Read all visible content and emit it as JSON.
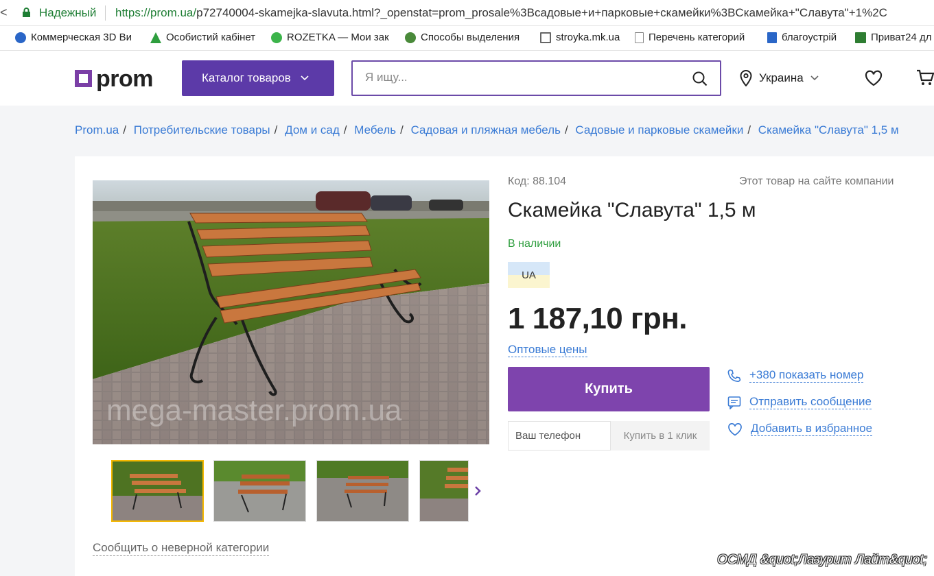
{
  "browser": {
    "back_glyph": "<",
    "secure_label": "Надежный",
    "url_host": "https://prom.ua/",
    "url_rest": "p72740004-skamejka-slavuta.html?_openstat=prom_prosale%3Bсадовые+и+парковые+скамейки%3BСкамейка+\"Славута\"+1%2C"
  },
  "bookmarks": [
    {
      "label": "Коммерческая 3D Ви",
      "icon": "3d-icon",
      "color": "#2a66c7"
    },
    {
      "label": "Особистий кабінет",
      "icon": "tree-icon",
      "color": "#2e9e3e"
    },
    {
      "label": "ROZETKA — Мои зак",
      "icon": "rozetka-icon",
      "color": "#3cb44b"
    },
    {
      "label": "Способы выделения",
      "icon": "frog-icon",
      "color": "#4a8a3a"
    },
    {
      "label": "stroyka.mk.ua",
      "icon": "building-icon",
      "color": "#666666"
    },
    {
      "label": "Перечень категорий",
      "icon": "page-icon",
      "color": "#888888"
    },
    {
      "label": "благоустрій",
      "icon": "doc-icon",
      "color": "#2a66c7"
    },
    {
      "label": "Приват24 дл",
      "icon": "privat-icon",
      "color": "#2e7d32"
    }
  ],
  "header": {
    "logo": "prom",
    "catalog_label": "Каталог товаров",
    "search_placeholder": "Я ищу...",
    "region": "Украина"
  },
  "breadcrumbs": [
    "Prom.ua",
    "Потребительские товары",
    "Дом и сад",
    "Мебель",
    "Садовая и пляжная мебель",
    "Садовые и парковые скамейки",
    "Скамейка \"Славута\" 1,5 м"
  ],
  "product": {
    "code": "Код: 88.104",
    "company_link": "Этот товар на сайте компании",
    "title": "Скамейка \"Славута\" 1,5 м",
    "availability": "В наличии",
    "flag_label": "UA",
    "price": "1 187,10 грн.",
    "wholesale_label": "Оптовые цены",
    "buy_label": "Купить",
    "phone_placeholder": "Ваш телефон",
    "one_click_label": "Купить в 1 клик",
    "watermark": "mega-master.prom.ua"
  },
  "actions": {
    "show_phone": "+380 показать номер",
    "send_message": "Отправить сообщение",
    "add_favorite": "Добавить в избранное"
  },
  "report_label": "Сообщить о неверной категории",
  "overlay_caption": "ОСМД &quot;Лазурит Лайт&quot;",
  "colors": {
    "brand": "#7e44ad",
    "link": "#3a7bd5",
    "in_stock": "#2e9e3e",
    "catalog_button": "#5c3aa8"
  }
}
